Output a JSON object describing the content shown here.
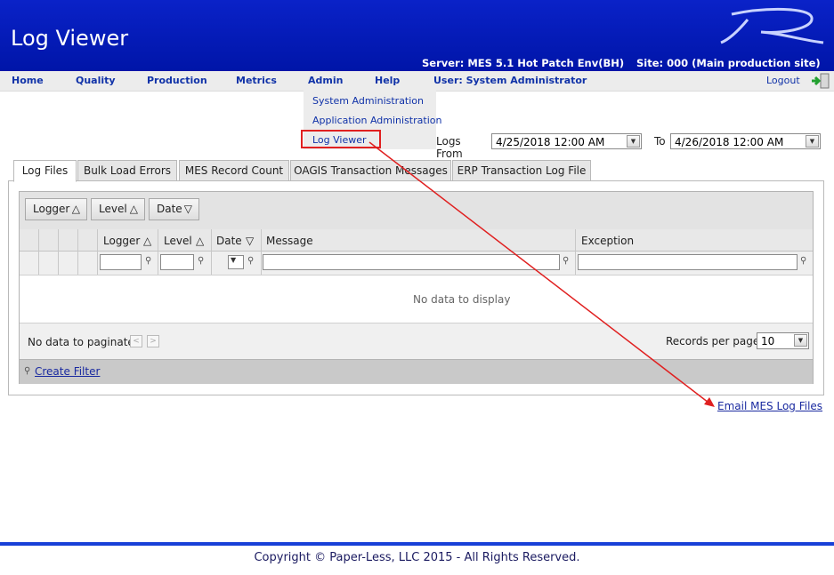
{
  "header": {
    "title": "Log Viewer",
    "server": "Server: MES 5.1 Hot Patch Env(BH)",
    "site": "Site: 000 (Main production site)"
  },
  "nav": {
    "items": [
      "Home",
      "Quality",
      "Production",
      "Metrics",
      "Admin",
      "Help"
    ],
    "user": "User: System Administrator",
    "logout": "Logout"
  },
  "admin_menu": {
    "items": [
      "System Administration",
      "Application Administration",
      "Log Viewer"
    ]
  },
  "filter": {
    "from_label": "Logs From",
    "from_value": "4/25/2018 12:00 AM",
    "to_label": "To",
    "to_value": "4/26/2018 12:00 AM"
  },
  "tabs": [
    "Log Files",
    "Bulk Load Errors",
    "MES Record Count",
    "OAGIS Transaction Messages",
    "ERP Transaction Log File"
  ],
  "grid": {
    "group_buttons": [
      "Logger",
      "Level",
      "Date"
    ],
    "columns": [
      "Logger",
      "Level",
      "Date",
      "Message",
      "Exception"
    ],
    "empty_text": "No data to display",
    "paginate_text": "No data to paginate",
    "records_label": "Records per page:",
    "records_value": "10",
    "create_filter": "Create Filter"
  },
  "email_link": "Email MES Log Files",
  "footer": "Copyright © Paper-Less, LLC 2015 - All Rights Reserved.",
  "colors": {
    "header_blue": "#0a22c8",
    "annotation_red": "#e02020",
    "link_blue": "#1a2aa0"
  }
}
